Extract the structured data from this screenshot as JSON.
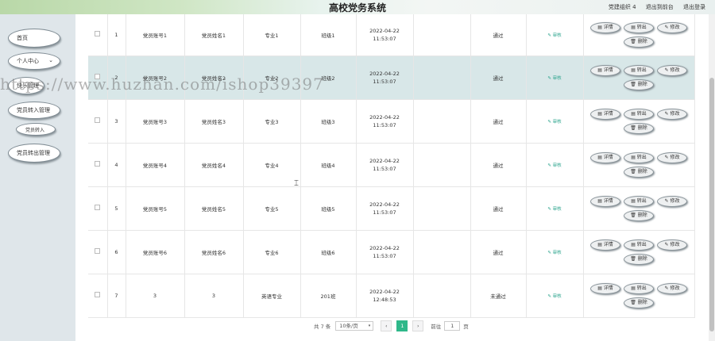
{
  "header": {
    "title": "高校党务系统",
    "links": [
      "党建组织 4",
      "退出到前台",
      "退出登录"
    ]
  },
  "sidebar": {
    "items": [
      {
        "label": "首页"
      },
      {
        "label": "个人中心"
      },
      {
        "label": "快乐管理"
      },
      {
        "label": "党员转入管理"
      },
      {
        "label": "党员转入"
      },
      {
        "label": "党员转出管理"
      }
    ]
  },
  "table": {
    "rows": [
      {
        "idx": "1",
        "c1": "党员账号1",
        "c2": "党员姓名1",
        "c3": "专业1",
        "c4": "班级1",
        "time": "2022-04-22 11:53:07",
        "status": "通过"
      },
      {
        "idx": "2",
        "c1": "党员账号2",
        "c2": "党员姓名2",
        "c3": "专业2",
        "c4": "班级2",
        "time": "2022-04-22 11:53:07",
        "status": "通过"
      },
      {
        "idx": "3",
        "c1": "党员账号3",
        "c2": "党员姓名3",
        "c3": "专业3",
        "c4": "班级3",
        "time": "2022-04-22 11:53:07",
        "status": "通过"
      },
      {
        "idx": "4",
        "c1": "党员账号4",
        "c2": "党员姓名4",
        "c3": "专业4",
        "c4": "班级4",
        "time": "2022-04-22 11:53:07",
        "status": "通过"
      },
      {
        "idx": "5",
        "c1": "党员账号5",
        "c2": "党员姓名5",
        "c3": "专业5",
        "c4": "班级5",
        "time": "2022-04-22 11:53:07",
        "status": "通过"
      },
      {
        "idx": "6",
        "c1": "党员账号6",
        "c2": "党员姓名6",
        "c3": "专业6",
        "c4": "班级6",
        "time": "2022-04-22 11:53:07",
        "status": "通过"
      },
      {
        "idx": "7",
        "c1": "3",
        "c2": "3",
        "c3": "英语专业",
        "c4": "201班",
        "time": "2022-04-22 12:48:53",
        "status": "未通过"
      }
    ],
    "audit_label": "审核",
    "btn_detail": "详情",
    "btn_transfer": "转出",
    "btn_edit": "修改",
    "btn_delete": "删除"
  },
  "pagination": {
    "total": "共 7 条",
    "page_size": "10条/页",
    "prev": "‹",
    "current": "1",
    "next": "›",
    "goto_label": "前往",
    "goto_value": "1",
    "page_unit": "页"
  },
  "watermark": "https://www.huzhan.com/ishop39397"
}
